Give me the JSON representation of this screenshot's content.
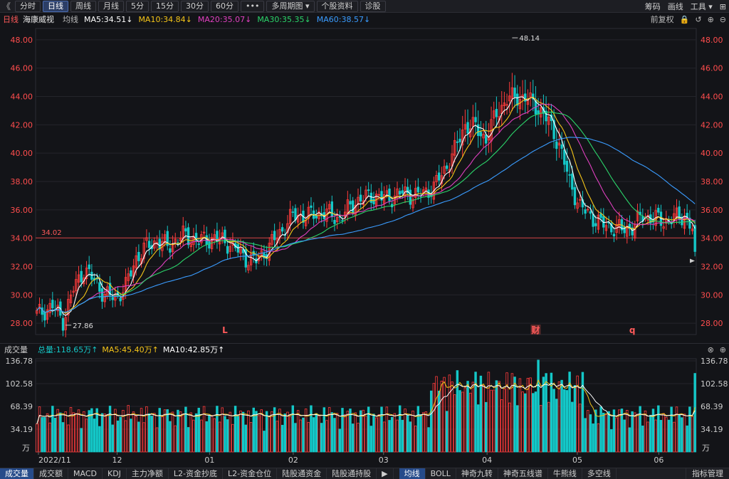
{
  "toolbar": {
    "back": "《",
    "tabs": [
      {
        "label": "分时",
        "active": false
      },
      {
        "label": "日线",
        "active": true
      },
      {
        "label": "周线",
        "active": false
      },
      {
        "label": "月线",
        "active": false
      },
      {
        "label": "5分",
        "active": false
      },
      {
        "label": "15分",
        "active": false
      },
      {
        "label": "30分",
        "active": false
      },
      {
        "label": "60分",
        "active": false
      },
      {
        "label": "•••",
        "active": false
      },
      {
        "label": "多周期图  ▾",
        "active": false
      },
      {
        "label": "个股资料",
        "active": false
      },
      {
        "label": "诊股",
        "active": false
      }
    ],
    "right": [
      "筹码",
      "画线",
      "工具 ▾",
      "⊞"
    ]
  },
  "ma_bar": {
    "period": "日线",
    "stock_name": "海康威视",
    "label": "均线",
    "items": [
      {
        "text": "MA5:34.51↓",
        "color": "#ffffff"
      },
      {
        "text": "MA10:34.84↓",
        "color": "#f5c518"
      },
      {
        "text": "MA20:35.07↓",
        "color": "#e040c0"
      },
      {
        "text": "MA30:35.35↓",
        "color": "#2bd46a"
      },
      {
        "text": "MA60:38.57↓",
        "color": "#3a9cff"
      }
    ],
    "right": [
      "前复权",
      "🔒",
      "↺",
      "⊕",
      "⊖"
    ]
  },
  "vol_bar": {
    "title": "成交量",
    "total": "总量:118.65万↑",
    "ma5": "MA5:45.40万↑",
    "ma10": "MA10:42.85万↑",
    "right": [
      "⊗",
      "⊕"
    ]
  },
  "bottom_tabs": {
    "items": [
      {
        "label": "成交量",
        "active": true
      },
      {
        "label": "成交额",
        "active": false
      },
      {
        "label": "MACD",
        "active": false
      },
      {
        "label": "KDJ",
        "active": false
      },
      {
        "label": "主力净额",
        "active": false
      },
      {
        "label": "L2-资金抄底",
        "active": false
      },
      {
        "label": "L2-资金仓位",
        "active": false
      },
      {
        "label": "陆股通资金",
        "active": false
      },
      {
        "label": "陆股通持股",
        "active": false
      },
      {
        "label": "▶",
        "active": false
      },
      {
        "label": "均线",
        "active": true
      },
      {
        "label": "BOLL",
        "active": false
      },
      {
        "label": "神奇九转",
        "active": false
      },
      {
        "label": "神奇五线谱",
        "active": false
      },
      {
        "label": "牛熊线",
        "active": false
      },
      {
        "label": "多空线",
        "active": false
      }
    ],
    "right": "指标管理"
  },
  "chart_data": {
    "type": "candlestick",
    "price_axis": {
      "ticks": [
        28,
        30,
        32,
        34,
        36,
        38,
        40,
        42,
        44,
        46,
        48
      ],
      "tick_labels": [
        "28.00",
        "30.00",
        "32.00",
        "34.00",
        "36.00",
        "38.00",
        "40.00",
        "42.00",
        "44.00",
        "46.00",
        "48.00"
      ],
      "ylim": [
        27.2,
        48.8
      ]
    },
    "volume_axis": {
      "ticks": [
        34.19,
        68.39,
        102.58,
        136.78
      ],
      "tick_labels": [
        "34.19",
        "68.39",
        "102.58",
        "136.78"
      ],
      "unit": "万",
      "ylim": [
        0,
        140
      ]
    },
    "x_tick_labels": [
      "2022/11",
      "12",
      "01",
      "02",
      "03",
      "04",
      "05",
      "06"
    ],
    "reference_line": {
      "value": 34.02,
      "label": "34.02"
    },
    "annotations": {
      "high": "48.14",
      "low": "27.86",
      "markers": [
        "L",
        "财",
        "q"
      ]
    },
    "colors": {
      "up": "#ff3b3b",
      "down": "#14c8c8",
      "ma5": "#ffffff",
      "ma10": "#f5c518",
      "ma20": "#e040c0",
      "ma30": "#2bd46a",
      "ma60": "#3a9cff"
    }
  }
}
